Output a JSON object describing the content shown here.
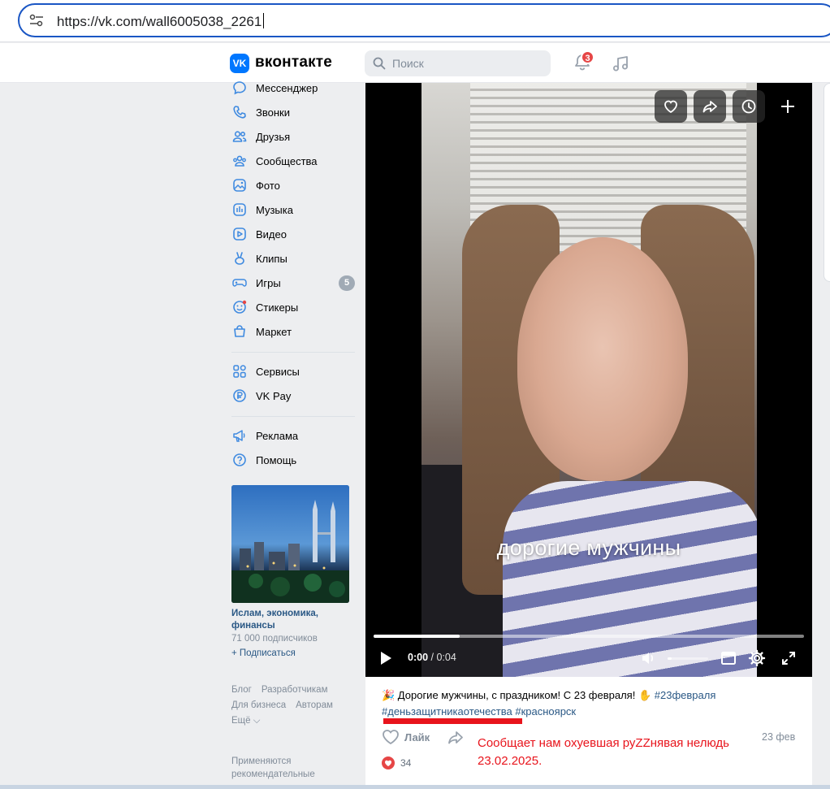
{
  "browser": {
    "url": "https://vk.com/wall6005038_2261"
  },
  "header": {
    "logo_text": "VK",
    "brand": "вконтакте",
    "search_placeholder": "Поиск",
    "notifications_count": "3"
  },
  "sidebar": {
    "items": [
      {
        "label": "Мессенджер",
        "icon": "message-icon"
      },
      {
        "label": "Звонки",
        "icon": "phone-icon"
      },
      {
        "label": "Друзья",
        "icon": "friends-icon"
      },
      {
        "label": "Сообщества",
        "icon": "communities-icon"
      },
      {
        "label": "Фото",
        "icon": "photo-icon"
      },
      {
        "label": "Музыка",
        "icon": "music-icon"
      },
      {
        "label": "Видео",
        "icon": "video-icon"
      },
      {
        "label": "Клипы",
        "icon": "clips-icon"
      },
      {
        "label": "Игры",
        "icon": "games-icon",
        "badge": "5"
      },
      {
        "label": "Стикеры",
        "icon": "stickers-icon"
      },
      {
        "label": "Маркет",
        "icon": "market-icon"
      },
      {
        "label": "Сервисы",
        "icon": "services-icon"
      },
      {
        "label": "VK Pay",
        "icon": "vkpay-icon"
      },
      {
        "label": "Реклама",
        "icon": "megaphone-icon"
      },
      {
        "label": "Помощь",
        "icon": "help-icon"
      }
    ],
    "promo": {
      "title": "Ислам, экономика, финансы",
      "subscribers": "71 000 подписчиков",
      "subscribe": "+ Подписаться"
    },
    "footer_links": [
      "Блог",
      "Разработчикам",
      "Для бизнеса",
      "Авторам",
      "Ещё ⌵"
    ],
    "footer_note": "Применяются рекомендательные"
  },
  "video": {
    "subtitle": "дорогие мужчины",
    "current_time": "0:00",
    "separator": " / ",
    "duration": "0:04",
    "progress": 0.2,
    "volume": 0.1
  },
  "post": {
    "text_emoji": "🎉",
    "text": " Дорогие мужчины, с праздником! С 23 февраля! ",
    "text_emoji2": "✋",
    "tags": [
      "#23февраля",
      "#деньзащитникаотечества",
      "#красноярск"
    ],
    "like_label": "Лайк",
    "likes": "34",
    "date": "23 фев",
    "annotation": "Сообщает нам охуевшая руZZнявая нелюдь 23.02.2025."
  },
  "colors": {
    "accent": "#0077ff",
    "link": "#2a5885",
    "annotation": "#e8141c"
  }
}
